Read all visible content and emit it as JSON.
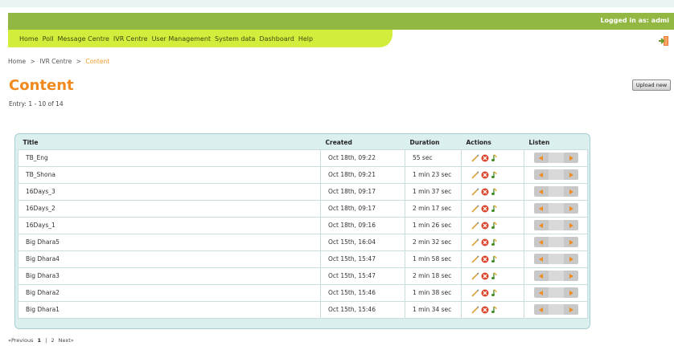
{
  "header": {
    "logged_in": "Logged in as: admi",
    "colors": {
      "top_bar": "#93b743",
      "nav_bar": "#d4ec3c",
      "title": "#f08a1e",
      "table_frame": "#dcefef"
    }
  },
  "nav": {
    "items": [
      {
        "label": "Home"
      },
      {
        "label": "Poll"
      },
      {
        "label": "Message Centre"
      },
      {
        "label": "IVR Centre"
      },
      {
        "label": "User Management"
      },
      {
        "label": "System data"
      },
      {
        "label": "Dashboard"
      },
      {
        "label": "Help"
      }
    ],
    "exit_icon": "exit-door-icon"
  },
  "breadcrumb": {
    "home": "Home",
    "sep": ">",
    "section": "IVR Centre",
    "current": "Content"
  },
  "page": {
    "title": "Content",
    "entry": "Entry: 1 - 10 of 14",
    "upload_label": "Upload new"
  },
  "table": {
    "headers": {
      "title": "Title",
      "created": "Created",
      "duration": "Duration",
      "actions": "Actions",
      "listen": "Listen"
    },
    "rows": [
      {
        "title": "TB_Eng",
        "created": "Oct 18th, 09:22",
        "duration": "55 sec"
      },
      {
        "title": "TB_Shona",
        "created": "Oct 18th, 09:21",
        "duration": "1 min 23 sec"
      },
      {
        "title": "16Days_3",
        "created": "Oct 18th, 09:17",
        "duration": "1 min 37 sec"
      },
      {
        "title": "16Days_2",
        "created": "Oct 18th, 09:17",
        "duration": "2 min 17 sec"
      },
      {
        "title": "16Days_1",
        "created": "Oct 18th, 09:16",
        "duration": "1 min 26 sec"
      },
      {
        "title": "Big Dhara5",
        "created": "Oct 15th, 16:04",
        "duration": "2 min 32 sec"
      },
      {
        "title": "Big Dhara4",
        "created": "Oct 15th, 15:47",
        "duration": "1 min 58 sec"
      },
      {
        "title": "Big Dhara3",
        "created": "Oct 15th, 15:47",
        "duration": "2 min 18 sec"
      },
      {
        "title": "Big Dhara2",
        "created": "Oct 15th, 15:46",
        "duration": "1 min 38 sec"
      },
      {
        "title": "Big Dhara1",
        "created": "Oct 15th, 15:46",
        "duration": "1 min 34 sec"
      }
    ],
    "row_icons": [
      "edit-pencil-icon",
      "delete-icon",
      "audio-note-icon"
    ],
    "player_icons": [
      "play-back-icon",
      "play-forward-icon"
    ]
  },
  "pager": {
    "prev": "«Previous",
    "page1": "1",
    "sep": "|",
    "page2": "2",
    "next": "Next»"
  }
}
